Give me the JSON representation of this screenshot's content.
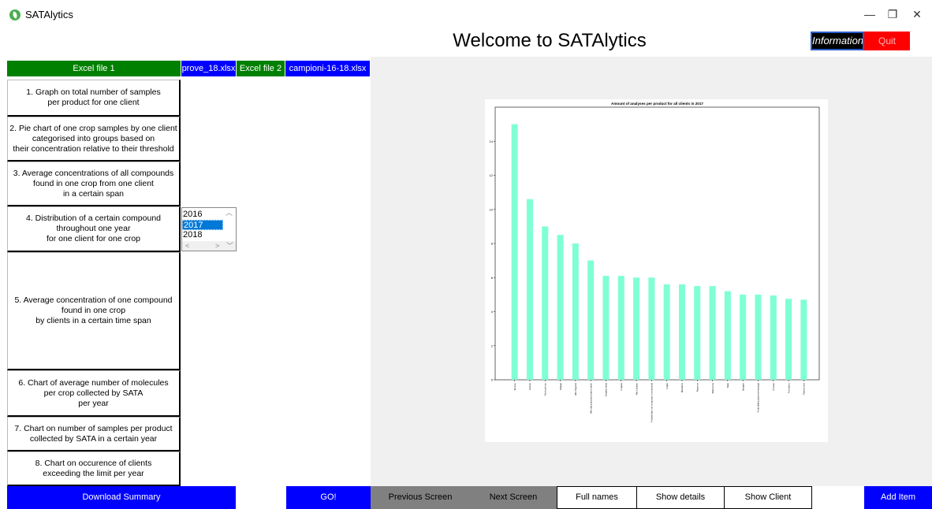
{
  "window": {
    "title": "SATAlytics",
    "controls": {
      "minimize": "—",
      "maximize": "❐",
      "close": "✕"
    }
  },
  "header": {
    "title": "Welcome to SATAlytics",
    "info_label": "Information",
    "quit_label": "Quit"
  },
  "files": {
    "file1_label": "Excel file 1",
    "file1_name": "prove_18.xlsx",
    "file2_label": "Excel file 2",
    "file2_name": "campioni-16-18.xlsx"
  },
  "menu": {
    "items": [
      {
        "label": "1. Graph on total number of samples\nper product for one client"
      },
      {
        "label": "2. Pie chart of one crop samples by one client\ncategorised into groups based on\ntheir concentration relative to their threshold"
      },
      {
        "label": "3. Average concentrations of all compounds\nfound in one crop from one client\nin a certain span"
      },
      {
        "label": "4. Distribution of a certain compound\nthroughout one year\nfor one client for one crop"
      },
      {
        "label": "5. Average concentration of one compound\nfound in one crop\nby clients in a certain time span"
      },
      {
        "label": "6. Chart of average number of molecules\nper crop collected by SATA\nper year"
      },
      {
        "label": "7. Chart on number of samples per product\ncollected by SATA in a certain year"
      },
      {
        "label": "8. Chart on occurence of clients\nexceeding the limit per year"
      }
    ]
  },
  "year_list": {
    "options": [
      "2016",
      "2017",
      "2018"
    ],
    "selected": "2017"
  },
  "bottom_bar": {
    "download_summary": "Download Summary",
    "go": "GO!",
    "previous_screen": "Previous Screen",
    "next_screen": "Next Screen",
    "full_names": "Full names",
    "show_details": "Show details",
    "show_client": "Show Client",
    "add_item": "Add Item"
  },
  "colors": {
    "bar": "#7fffd4",
    "blue_button": "#0000ff",
    "green_header": "#008000",
    "quit": "#ff0000",
    "selection": "#0078d7"
  },
  "chart_data": {
    "type": "bar",
    "title": "Amount of analyses per product for all clients in 2017",
    "xlabel": "",
    "ylabel": "",
    "ylim": [
      0,
      16
    ],
    "yticks": [
      0,
      2,
      4,
      6,
      8,
      10,
      12,
      14
    ],
    "categories": [
      "Tarocco",
      "Arance",
      "Farina di riso",
      "Ciliegie",
      "Albi Organici",
      "Albi ottica piccola frutta e tuberi",
      "Insalata mista",
      "Fragole",
      "Albi Lamiaio",
      "Prodotti labo rat' composto e concentrati",
      "Foglie",
      "Mandarini",
      "Peperoni",
      "Albicocche",
      "Mais",
      "Vangelo",
      "Frutti della passione/maracuja",
      "Pomelo",
      "Pomodoro",
      "Peperoncini"
    ],
    "values": [
      15.0,
      10.6,
      9.0,
      8.5,
      8.0,
      7.0,
      6.1,
      6.1,
      6.0,
      6.0,
      5.6,
      5.6,
      5.5,
      5.5,
      5.2,
      5.0,
      5.0,
      4.95,
      4.75,
      4.7
    ],
    "grid": false,
    "legend": "none"
  }
}
